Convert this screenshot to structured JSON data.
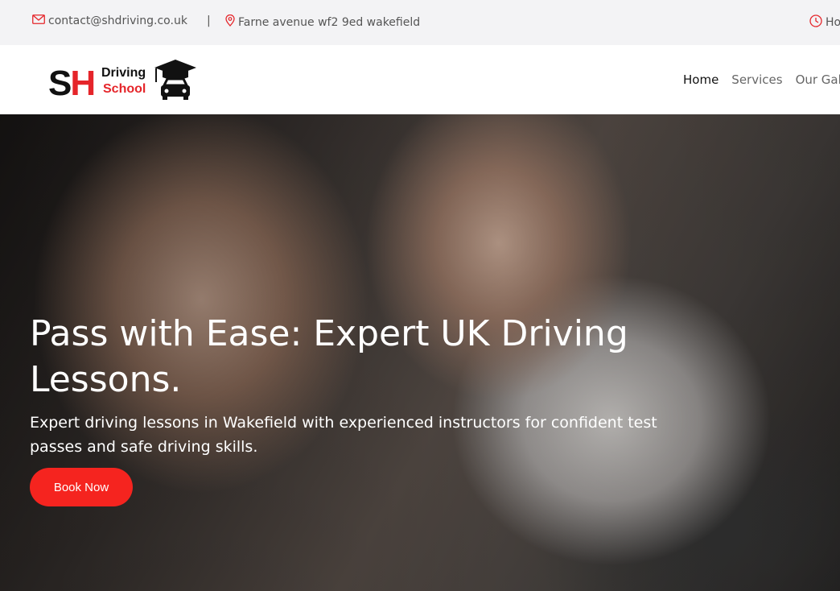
{
  "topbar": {
    "email": "contact@shdriving.co.uk",
    "separator": "|",
    "address": "Farne avenue wf2 9ed wakefield",
    "hours_partial": "Ho"
  },
  "logo": {
    "letters_s": "S",
    "letters_h": "H",
    "word1": "Driving",
    "word2": "School"
  },
  "nav": {
    "items": [
      "Home",
      "Services",
      "Our Galle"
    ]
  },
  "hero": {
    "title": "Pass with Ease: Expert UK Driving Lessons.",
    "subtitle": "Expert driving lessons in Wakefield with experienced instructors for confident test passes and safe driving skills.",
    "cta": "Book Now"
  },
  "colors": {
    "accent": "#f5241f",
    "brand_red": "#e5252a",
    "topbar_bg": "#f3f3f5"
  },
  "icons": [
    "envelope-icon",
    "map-pin-icon",
    "clock-icon",
    "graduation-car-icon"
  ]
}
